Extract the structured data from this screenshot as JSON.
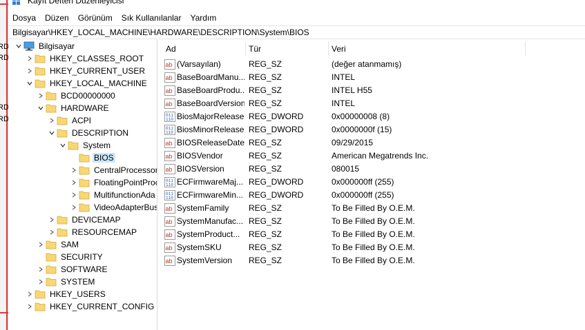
{
  "window": {
    "title": "Kayıt Defteri Düzenleyicisi"
  },
  "background_fragments": [
    "RD",
    "RD",
    "RD",
    "RD"
  ],
  "menu": [
    "Dosya",
    "Düzen",
    "Görünüm",
    "Sık Kullanılanlar",
    "Yardım"
  ],
  "address": "Bilgisayar\\HKEY_LOCAL_MACHINE\\HARDWARE\\DESCRIPTION\\System\\BIOS",
  "tree": [
    {
      "label": "Bilgisayar",
      "depth": 0,
      "expander": "expanded",
      "icon": "computer-icon"
    },
    {
      "label": "HKEY_CLASSES_ROOT",
      "depth": 1,
      "expander": "collapsed",
      "icon": "folder-icon"
    },
    {
      "label": "HKEY_CURRENT_USER",
      "depth": 1,
      "expander": "collapsed",
      "icon": "folder-icon"
    },
    {
      "label": "HKEY_LOCAL_MACHINE",
      "depth": 1,
      "expander": "expanded",
      "icon": "folder-icon"
    },
    {
      "label": "BCD00000000",
      "depth": 2,
      "expander": "collapsed",
      "icon": "folder-icon"
    },
    {
      "label": "HARDWARE",
      "depth": 2,
      "expander": "expanded",
      "icon": "folder-icon"
    },
    {
      "label": "ACPI",
      "depth": 3,
      "expander": "collapsed",
      "icon": "folder-icon"
    },
    {
      "label": "DESCRIPTION",
      "depth": 3,
      "expander": "expanded",
      "icon": "folder-icon"
    },
    {
      "label": "System",
      "depth": 4,
      "expander": "expanded",
      "icon": "folder-icon"
    },
    {
      "label": "BIOS",
      "depth": 5,
      "expander": "none",
      "icon": "folder-icon",
      "selected": true
    },
    {
      "label": "CentralProcessor",
      "depth": 5,
      "expander": "collapsed",
      "icon": "folder-icon"
    },
    {
      "label": "FloatingPointProc",
      "depth": 5,
      "expander": "collapsed",
      "icon": "folder-icon"
    },
    {
      "label": "MultifunctionAda",
      "depth": 5,
      "expander": "collapsed",
      "icon": "folder-icon"
    },
    {
      "label": "VideoAdapterBus",
      "depth": 5,
      "expander": "collapsed",
      "icon": "folder-icon"
    },
    {
      "label": "DEVICEMAP",
      "depth": 3,
      "expander": "collapsed",
      "icon": "folder-icon"
    },
    {
      "label": "RESOURCEMAP",
      "depth": 3,
      "expander": "collapsed",
      "icon": "folder-icon"
    },
    {
      "label": "SAM",
      "depth": 2,
      "expander": "collapsed",
      "icon": "folder-icon"
    },
    {
      "label": "SECURITY",
      "depth": 2,
      "expander": "none",
      "icon": "folder-icon"
    },
    {
      "label": "SOFTWARE",
      "depth": 2,
      "expander": "collapsed",
      "icon": "folder-icon"
    },
    {
      "label": "SYSTEM",
      "depth": 2,
      "expander": "collapsed",
      "icon": "folder-icon"
    },
    {
      "label": "HKEY_USERS",
      "depth": 1,
      "expander": "collapsed",
      "icon": "folder-icon"
    },
    {
      "label": "HKEY_CURRENT_CONFIG",
      "depth": 1,
      "expander": "collapsed",
      "icon": "folder-icon"
    }
  ],
  "columns": {
    "name": "Ad",
    "type": "Tür",
    "data": "Veri"
  },
  "values": [
    {
      "name": "(Varsayılan)",
      "type": "REG_SZ",
      "data": "(değer atanmamış)",
      "icon": "string-value-icon"
    },
    {
      "name": "BaseBoardManu...",
      "type": "REG_SZ",
      "data": "INTEL",
      "icon": "string-value-icon"
    },
    {
      "name": "BaseBoardProdu...",
      "type": "REG_SZ",
      "data": "INTEL H55",
      "icon": "string-value-icon"
    },
    {
      "name": "BaseBoardVersion",
      "type": "REG_SZ",
      "data": "INTEL",
      "icon": "string-value-icon"
    },
    {
      "name": "BiosMajorRelease",
      "type": "REG_DWORD",
      "data": "0x00000008 (8)",
      "icon": "binary-value-icon"
    },
    {
      "name": "BiosMinorRelease",
      "type": "REG_DWORD",
      "data": "0x0000000f (15)",
      "icon": "binary-value-icon"
    },
    {
      "name": "BIOSReleaseDate",
      "type": "REG_SZ",
      "data": "09/29/2015",
      "icon": "string-value-icon"
    },
    {
      "name": "BIOSVendor",
      "type": "REG_SZ",
      "data": "American Megatrends Inc.",
      "icon": "string-value-icon"
    },
    {
      "name": "BIOSVersion",
      "type": "REG_SZ",
      "data": "080015",
      "icon": "string-value-icon"
    },
    {
      "name": "ECFirmwareMaj...",
      "type": "REG_DWORD",
      "data": "0x000000ff (255)",
      "icon": "binary-value-icon"
    },
    {
      "name": "ECFirmwareMin...",
      "type": "REG_DWORD",
      "data": "0x000000ff (255)",
      "icon": "binary-value-icon"
    },
    {
      "name": "SystemFamily",
      "type": "REG_SZ",
      "data": "To Be Filled By O.E.M.",
      "icon": "string-value-icon"
    },
    {
      "name": "SystemManufac...",
      "type": "REG_SZ",
      "data": "To Be Filled By O.E.M.",
      "icon": "string-value-icon"
    },
    {
      "name": "SystemProduct...",
      "type": "REG_SZ",
      "data": "To Be Filled By O.E.M.",
      "icon": "string-value-icon"
    },
    {
      "name": "SystemSKU",
      "type": "REG_SZ",
      "data": "To Be Filled By O.E.M.",
      "icon": "string-value-icon"
    },
    {
      "name": "SystemVersion",
      "type": "REG_SZ",
      "data": "To Be Filled By O.E.M.",
      "icon": "string-value-icon"
    }
  ],
  "colors": {
    "selection": "#cce8ff",
    "folder": "#f8d775",
    "string_icon": "#c0392b",
    "binary_icon": "#2b5fb3"
  }
}
